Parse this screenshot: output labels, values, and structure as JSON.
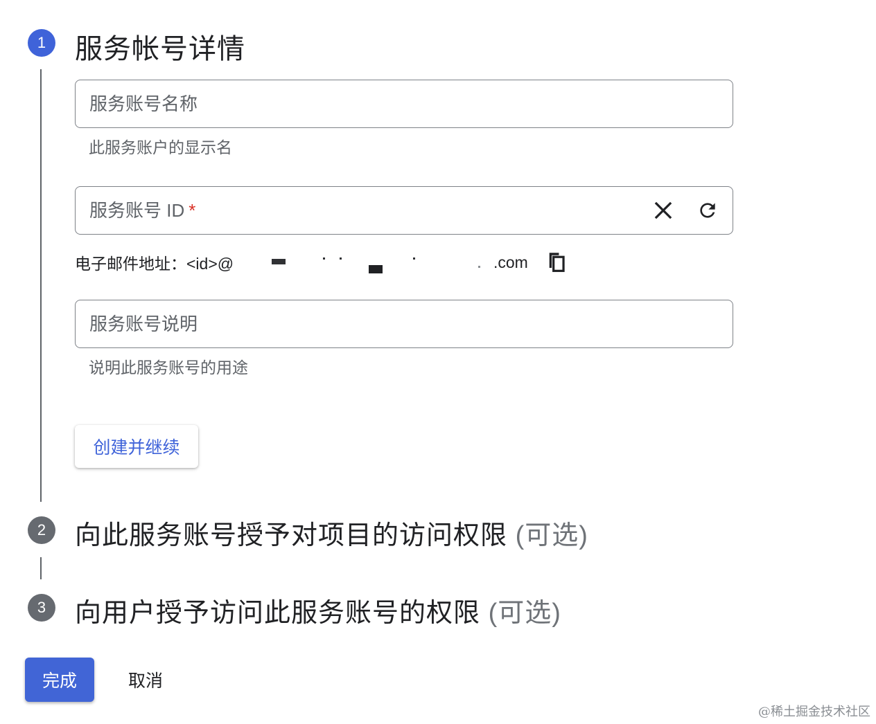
{
  "steps": [
    {
      "number": "1",
      "title": "服务帐号详情",
      "optional": ""
    },
    {
      "number": "2",
      "title": "向此服务账号授予对项目的访问权限",
      "optional": "(可选)"
    },
    {
      "number": "3",
      "title": "向用户授予访问此服务账号的权限",
      "optional": "(可选)"
    }
  ],
  "form": {
    "name_field": {
      "placeholder": "服务账号名称",
      "value": "",
      "hint": "此服务账户的显示名"
    },
    "id_field": {
      "placeholder": "服务账号 ID",
      "required_mark": "*",
      "value": "",
      "clear_icon": "close-icon",
      "refresh_icon": "refresh-icon"
    },
    "email": {
      "label": "电子邮件地址：",
      "value_prefix": "<id>@",
      "value_suffix": ".com",
      "copy_icon": "copy-icon"
    },
    "description_field": {
      "placeholder": "服务账号说明",
      "value": "",
      "hint": "说明此服务账号的用途"
    },
    "create_button": "创建并继续"
  },
  "footer": {
    "done_button": "完成",
    "cancel_button": "取消"
  },
  "watermark": "@稀土掘金技术社区",
  "colors": {
    "accent": "#3f63d9",
    "required": "#d93025",
    "inactive_step": "#666a70"
  }
}
